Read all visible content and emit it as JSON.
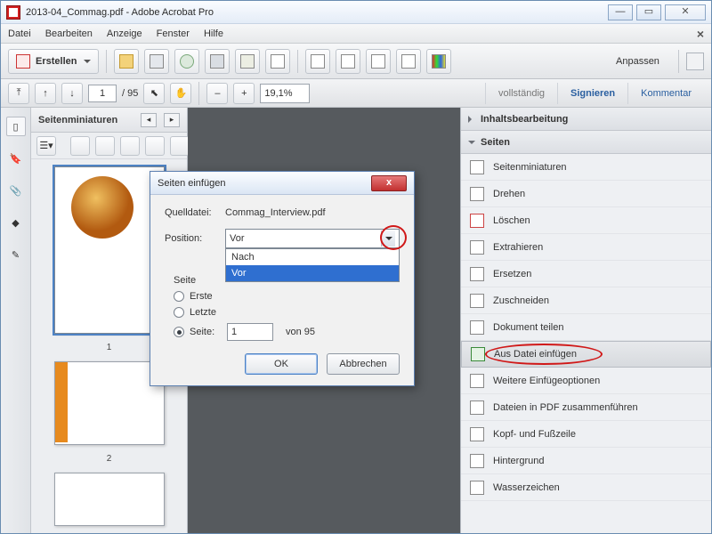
{
  "window": {
    "title": "2013-04_Commag.pdf - Adobe Acrobat Pro"
  },
  "menu": {
    "items": [
      "Datei",
      "Bearbeiten",
      "Anzeige",
      "Fenster",
      "Hilfe"
    ]
  },
  "toolbar": {
    "create": "Erstellen",
    "customize": "Anpassen"
  },
  "toolbar2": {
    "page": "1",
    "pages": "95",
    "zoom": "19,1%"
  },
  "rtabs": {
    "a": "vollständig",
    "b": "Signieren",
    "c": "Kommentar"
  },
  "thumbs": {
    "title": "Seitenminiaturen",
    "p1": "1",
    "p2": "2"
  },
  "rpanel": {
    "acc1": "Inhaltsbearbeitung",
    "acc2": "Seiten",
    "items": [
      "Seitenminiaturen",
      "Drehen",
      "Löschen",
      "Extrahieren",
      "Ersetzen",
      "Zuschneiden",
      "Dokument teilen",
      "Aus Datei einfügen",
      "Weitere Einfügeoptionen",
      "Dateien in PDF zusammenführen",
      "Kopf- und Fußzeile",
      "Hintergrund",
      "Wasserzeichen"
    ]
  },
  "dialog": {
    "title": "Seiten einfügen",
    "srclabel": "Quelldatei:",
    "srcfile": "Commag_Interview.pdf",
    "poslabel": "Position:",
    "posval": "Vor",
    "opts": {
      "nach": "Nach",
      "vor": "Vor"
    },
    "seite": "Seite",
    "erste": "Erste",
    "letzte": "Letzte",
    "seite2": "Seite:",
    "pagenum": "1",
    "von": "von 95",
    "ok": "OK",
    "cancel": "Abbrechen"
  }
}
